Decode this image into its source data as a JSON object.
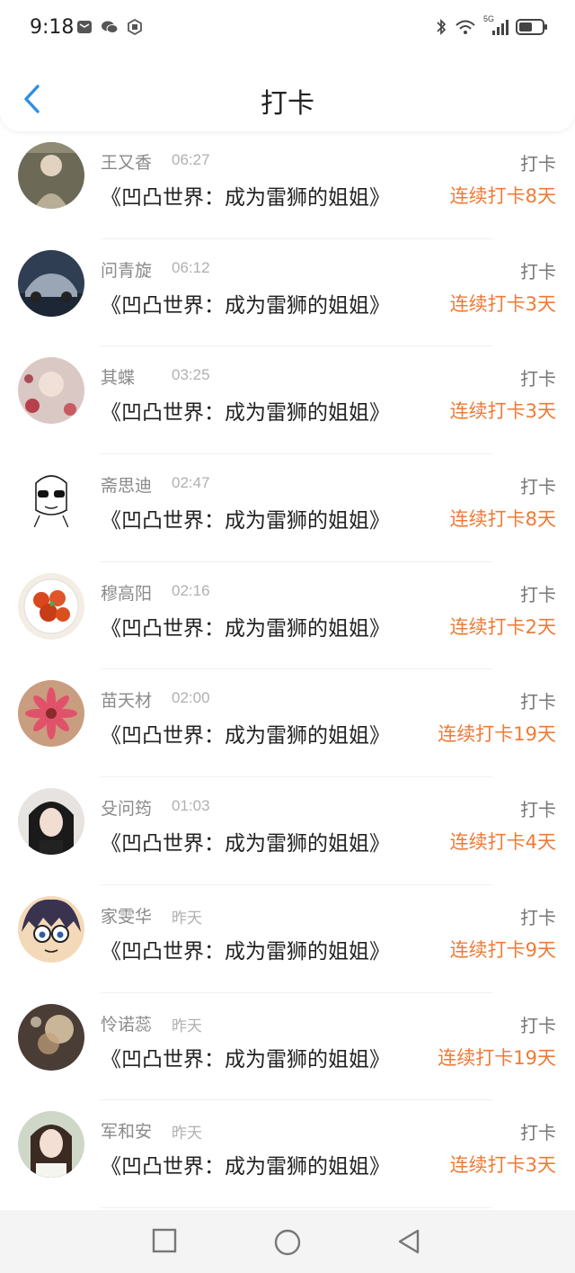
{
  "status_bar": {
    "time": "9:18",
    "network": "5G"
  },
  "header": {
    "title": "打卡"
  },
  "checkins": [
    {
      "name": "王又香",
      "time": "06:27",
      "book": "《凹凸世界：成为雷狮的姐姐》",
      "action": "打卡",
      "streak": "连续打卡8天",
      "avatar": "woman-portrait"
    },
    {
      "name": "问青旋",
      "time": "06:12",
      "book": "《凹凸世界：成为雷狮的姐姐》",
      "action": "打卡",
      "streak": "连续打卡3天",
      "avatar": "sports-car"
    },
    {
      "name": "其蝶",
      "time": "03:25",
      "book": "《凹凸世界：成为雷狮的姐姐》",
      "action": "打卡",
      "streak": "连续打卡3天",
      "avatar": "floral-hands"
    },
    {
      "name": "斋思迪",
      "time": "02:47",
      "book": "《凹凸世界：成为雷狮的姐姐》",
      "action": "打卡",
      "streak": "连续打卡8天",
      "avatar": "sketch-girl-sunglasses"
    },
    {
      "name": "穆高阳",
      "time": "02:16",
      "book": "《凹凸世界：成为雷狮的姐姐》",
      "action": "打卡",
      "streak": "连续打卡2天",
      "avatar": "crayfish-dish"
    },
    {
      "name": "苗天材",
      "time": "02:00",
      "book": "《凹凸世界：成为雷狮的姐姐》",
      "action": "打卡",
      "streak": "连续打卡19天",
      "avatar": "pink-flower"
    },
    {
      "name": "殳问筠",
      "time": "01:03",
      "book": "《凹凸世界：成为雷狮的姐姐》",
      "action": "打卡",
      "streak": "连续打卡4天",
      "avatar": "woman-dark-hair"
    },
    {
      "name": "家雯华",
      "time": "昨天",
      "book": "《凹凸世界：成为雷狮的姐姐》",
      "action": "打卡",
      "streak": "连续打卡9天",
      "avatar": "anime-boy-glasses"
    },
    {
      "name": "怜诺蕊",
      "time": "昨天",
      "book": "《凹凸世界：成为雷狮的姐姐》",
      "action": "打卡",
      "streak": "连续打卡19天",
      "avatar": "soft-light-portrait"
    },
    {
      "name": "军和安",
      "time": "昨天",
      "book": "《凹凸世界：成为雷狮的姐姐》",
      "action": "打卡",
      "streak": "连续打卡3天",
      "avatar": "girl-portrait"
    }
  ],
  "colors": {
    "accent_blue": "#2f8ee8",
    "streak_orange": "#f07a35",
    "secondary_text": "#8a8a8a"
  },
  "bottom_nav": {
    "icons": [
      "square-icon",
      "circle-icon",
      "triangle-back-icon"
    ]
  }
}
